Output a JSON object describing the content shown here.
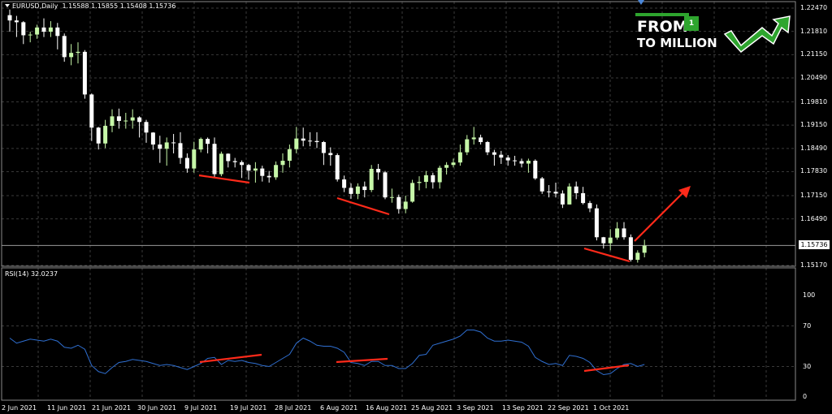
{
  "price_header": {
    "symbol": "EURUSD,Daily",
    "ohlc": "1.15588 1.15855 1.15408 1.15736"
  },
  "rsi_header": {
    "label": "RSI(14) 32.0237"
  },
  "price_axis": {
    "labels": [
      "1.22470",
      "1.21810",
      "1.21150",
      "1.20490",
      "1.19810",
      "1.19150",
      "1.18490",
      "1.17830",
      "1.17150",
      "1.16490",
      "1.15170"
    ],
    "values": [
      1.2247,
      1.2181,
      1.2115,
      1.2049,
      1.1981,
      1.1915,
      1.1849,
      1.1783,
      1.1715,
      1.1649,
      1.1517
    ],
    "current_price": "1.15736",
    "current_value": 1.15736
  },
  "rsi_axis": {
    "labels": [
      "100",
      "70",
      "30",
      "0"
    ],
    "values": [
      100,
      70,
      30,
      0
    ]
  },
  "date_axis": {
    "labels": [
      "2 Jun 2021",
      "11 Jun 2021",
      "21 Jun 2021",
      "30 Jun 2021",
      "9 Jul 2021",
      "19 Jul 2021",
      "28 Jul 2021",
      "6 Aug 2021",
      "16 Aug 2021",
      "25 Aug 2021",
      "3 Sep 2021",
      "13 Sep 2021",
      "22 Sep 2021",
      "1 Oct 2021"
    ]
  },
  "logo": {
    "line1": "FROM",
    "badge": "1",
    "line2": "TO MILLION"
  },
  "colors": {
    "background": "#000000",
    "grid": "#3a3a3a",
    "bull_candle": "#c6f7a8",
    "bear_candle": "#ffffff",
    "rsi_line": "#2f6fd1",
    "annotation": "#ff2a1a",
    "logo_green": "#2ea52e"
  },
  "chart_data": [
    {
      "type": "candlestick",
      "title": "EURUSD,Daily",
      "ylim": [
        1.1517,
        1.2247
      ],
      "x": [
        "2021-06-01",
        "2021-06-02",
        "2021-06-03",
        "2021-06-04",
        "2021-06-07",
        "2021-06-08",
        "2021-06-09",
        "2021-06-10",
        "2021-06-11",
        "2021-06-14",
        "2021-06-15",
        "2021-06-16",
        "2021-06-17",
        "2021-06-18",
        "2021-06-21",
        "2021-06-22",
        "2021-06-23",
        "2021-06-24",
        "2021-06-25",
        "2021-06-28",
        "2021-06-29",
        "2021-06-30",
        "2021-07-01",
        "2021-07-02",
        "2021-07-05",
        "2021-07-06",
        "2021-07-07",
        "2021-07-08",
        "2021-07-09",
        "2021-07-12",
        "2021-07-13",
        "2021-07-14",
        "2021-07-15",
        "2021-07-16",
        "2021-07-19",
        "2021-07-20",
        "2021-07-21",
        "2021-07-22",
        "2021-07-23",
        "2021-07-26",
        "2021-07-27",
        "2021-07-28",
        "2021-07-29",
        "2021-07-30",
        "2021-08-02",
        "2021-08-03",
        "2021-08-04",
        "2021-08-05",
        "2021-08-06",
        "2021-08-09",
        "2021-08-10",
        "2021-08-11",
        "2021-08-12",
        "2021-08-13",
        "2021-08-16",
        "2021-08-17",
        "2021-08-18",
        "2021-08-19",
        "2021-08-20",
        "2021-08-23",
        "2021-08-24",
        "2021-08-25",
        "2021-08-26",
        "2021-08-27",
        "2021-08-30",
        "2021-08-31",
        "2021-09-01",
        "2021-09-02",
        "2021-09-03",
        "2021-09-06",
        "2021-09-07",
        "2021-09-08",
        "2021-09-09",
        "2021-09-10",
        "2021-09-13",
        "2021-09-14",
        "2021-09-15",
        "2021-09-16",
        "2021-09-17",
        "2021-09-20",
        "2021-09-21",
        "2021-09-22",
        "2021-09-23",
        "2021-09-24",
        "2021-09-27",
        "2021-09-28",
        "2021-09-29",
        "2021-09-30",
        "2021-10-01",
        "2021-10-04",
        "2021-10-05",
        "2021-10-06",
        "2021-10-07",
        "2021-10-08"
      ],
      "close": [
        1.2212,
        1.2207,
        1.217,
        1.2172,
        1.2192,
        1.218,
        1.2192,
        1.2168,
        1.2108,
        1.212,
        1.2123,
        1.2002,
        1.1908,
        1.1863,
        1.1913,
        1.194,
        1.1927,
        1.1928,
        1.1937,
        1.1924,
        1.1894,
        1.186,
        1.1848,
        1.1866,
        1.1864,
        1.1822,
        1.1792,
        1.1846,
        1.1876,
        1.1862,
        1.1776,
        1.1834,
        1.1813,
        1.181,
        1.1802,
        1.1786,
        1.1792,
        1.1771,
        1.1767,
        1.1802,
        1.1814,
        1.1847,
        1.1877,
        1.1871,
        1.187,
        1.1867,
        1.1836,
        1.183,
        1.1761,
        1.1737,
        1.172,
        1.1741,
        1.1731,
        1.1791,
        1.1781,
        1.171,
        1.1711,
        1.1677,
        1.1698,
        1.1751,
        1.1754,
        1.1773,
        1.1753,
        1.1794,
        1.1802,
        1.1809,
        1.1838,
        1.1875,
        1.188,
        1.1867,
        1.1838,
        1.1831,
        1.1823,
        1.1815,
        1.1813,
        1.1806,
        1.1814,
        1.1764,
        1.1727,
        1.1726,
        1.1721,
        1.169,
        1.1741,
        1.1722,
        1.1694,
        1.1679,
        1.1597,
        1.158,
        1.1596,
        1.1622,
        1.1597,
        1.1533,
        1.1553,
        1.1573
      ],
      "high": [
        1.2243,
        1.2225,
        1.221,
        1.218,
        1.22,
        1.2218,
        1.221,
        1.2205,
        1.2175,
        1.2145,
        1.215,
        1.2128,
        1.2005,
        1.191,
        1.193,
        1.196,
        1.1962,
        1.195,
        1.196,
        1.194,
        1.193,
        1.1895,
        1.1885,
        1.188,
        1.189,
        1.1895,
        1.1835,
        1.1868,
        1.188,
        1.188,
        1.188,
        1.184,
        1.1835,
        1.1822,
        1.1815,
        1.1805,
        1.181,
        1.18,
        1.1785,
        1.1812,
        1.1835,
        1.186,
        1.191,
        1.1908,
        1.1895,
        1.1895,
        1.187,
        1.1852,
        1.1835,
        1.1772,
        1.175,
        1.175,
        1.1755,
        1.1802,
        1.1805,
        1.1785,
        1.1735,
        1.1718,
        1.1715,
        1.176,
        1.177,
        1.1785,
        1.178,
        1.18,
        1.181,
        1.182,
        1.186,
        1.1887,
        1.191,
        1.1888,
        1.187,
        1.1845,
        1.1842,
        1.183,
        1.1828,
        1.182,
        1.182,
        1.1818,
        1.1768,
        1.1745,
        1.1752,
        1.173,
        1.175,
        1.1755,
        1.174,
        1.17,
        1.169,
        1.1598,
        1.162,
        1.164,
        1.164,
        1.1605,
        1.156,
        1.159
      ],
      "low": [
        1.218,
        1.2165,
        1.2145,
        1.215,
        1.216,
        1.2165,
        1.2165,
        1.213,
        1.2095,
        1.2085,
        1.209,
        1.199,
        1.187,
        1.1846,
        1.185,
        1.1895,
        1.1905,
        1.1905,
        1.1905,
        1.188,
        1.1865,
        1.1845,
        1.1808,
        1.18,
        1.1835,
        1.1805,
        1.178,
        1.178,
        1.1838,
        1.1835,
        1.1765,
        1.177,
        1.1795,
        1.1795,
        1.1765,
        1.176,
        1.1752,
        1.1755,
        1.1752,
        1.176,
        1.178,
        1.1795,
        1.1835,
        1.1855,
        1.1855,
        1.185,
        1.1802,
        1.18,
        1.1755,
        1.1725,
        1.1706,
        1.1705,
        1.171,
        1.1725,
        1.176,
        1.1705,
        1.1695,
        1.1664,
        1.1665,
        1.1695,
        1.173,
        1.1736,
        1.1735,
        1.1735,
        1.1775,
        1.1795,
        1.18,
        1.183,
        1.186,
        1.186,
        1.183,
        1.18,
        1.1805,
        1.18,
        1.18,
        1.1795,
        1.178,
        1.176,
        1.172,
        1.171,
        1.171,
        1.168,
        1.169,
        1.1705,
        1.169,
        1.1668,
        1.1588,
        1.1565,
        1.156,
        1.159,
        1.159,
        1.1528,
        1.1525,
        1.154
      ]
    },
    {
      "type": "line",
      "title": "RSI(14) 32.0237",
      "ylim": [
        0,
        100
      ],
      "levels": [
        30,
        70
      ],
      "x": [
        "2021-06-01",
        "2021-06-02",
        "2021-06-03",
        "2021-06-04",
        "2021-06-07",
        "2021-06-08",
        "2021-06-09",
        "2021-06-10",
        "2021-06-11",
        "2021-06-14",
        "2021-06-15",
        "2021-06-16",
        "2021-06-17",
        "2021-06-18",
        "2021-06-21",
        "2021-06-22",
        "2021-06-23",
        "2021-06-24",
        "2021-06-25",
        "2021-06-28",
        "2021-06-29",
        "2021-06-30",
        "2021-07-01",
        "2021-07-02",
        "2021-07-05",
        "2021-07-06",
        "2021-07-07",
        "2021-07-08",
        "2021-07-09",
        "2021-07-12",
        "2021-07-13",
        "2021-07-14",
        "2021-07-15",
        "2021-07-16",
        "2021-07-19",
        "2021-07-20",
        "2021-07-21",
        "2021-07-22",
        "2021-07-23",
        "2021-07-26",
        "2021-07-27",
        "2021-07-28",
        "2021-07-29",
        "2021-07-30",
        "2021-08-02",
        "2021-08-03",
        "2021-08-04",
        "2021-08-05",
        "2021-08-06",
        "2021-08-09",
        "2021-08-10",
        "2021-08-11",
        "2021-08-12",
        "2021-08-13",
        "2021-08-16",
        "2021-08-17",
        "2021-08-18",
        "2021-08-19",
        "2021-08-20",
        "2021-08-23",
        "2021-08-24",
        "2021-08-25",
        "2021-08-26",
        "2021-08-27",
        "2021-08-30",
        "2021-08-31",
        "2021-09-01",
        "2021-09-02",
        "2021-09-03",
        "2021-09-06",
        "2021-09-07",
        "2021-09-08",
        "2021-09-09",
        "2021-09-10",
        "2021-09-13",
        "2021-09-14",
        "2021-09-15",
        "2021-09-16",
        "2021-09-17",
        "2021-09-20",
        "2021-09-21",
        "2021-09-22",
        "2021-09-23",
        "2021-09-24",
        "2021-09-27",
        "2021-09-28",
        "2021-09-29",
        "2021-09-30",
        "2021-10-01",
        "2021-10-04",
        "2021-10-05",
        "2021-10-06",
        "2021-10-07",
        "2021-10-08"
      ],
      "values": [
        58,
        53,
        55,
        57,
        56,
        55,
        57,
        55,
        49,
        48,
        51,
        47,
        31,
        25,
        23,
        29,
        34,
        35,
        37,
        36,
        35,
        33,
        31,
        32,
        31,
        29,
        27,
        30,
        33,
        38,
        39,
        32,
        36,
        35,
        36,
        34,
        33,
        31,
        30,
        34,
        38,
        42,
        53,
        58,
        55,
        51,
        50,
        50,
        48,
        44,
        34,
        33,
        31,
        35,
        35,
        31,
        31,
        28,
        28,
        33,
        41,
        42,
        51,
        53,
        55,
        57,
        60,
        66,
        66,
        64,
        58,
        55,
        55,
        56,
        55,
        54,
        50,
        39,
        35,
        32,
        33,
        31,
        41,
        40,
        38,
        34,
        26,
        22,
        23,
        28,
        32,
        33,
        30,
        32
      ]
    }
  ]
}
